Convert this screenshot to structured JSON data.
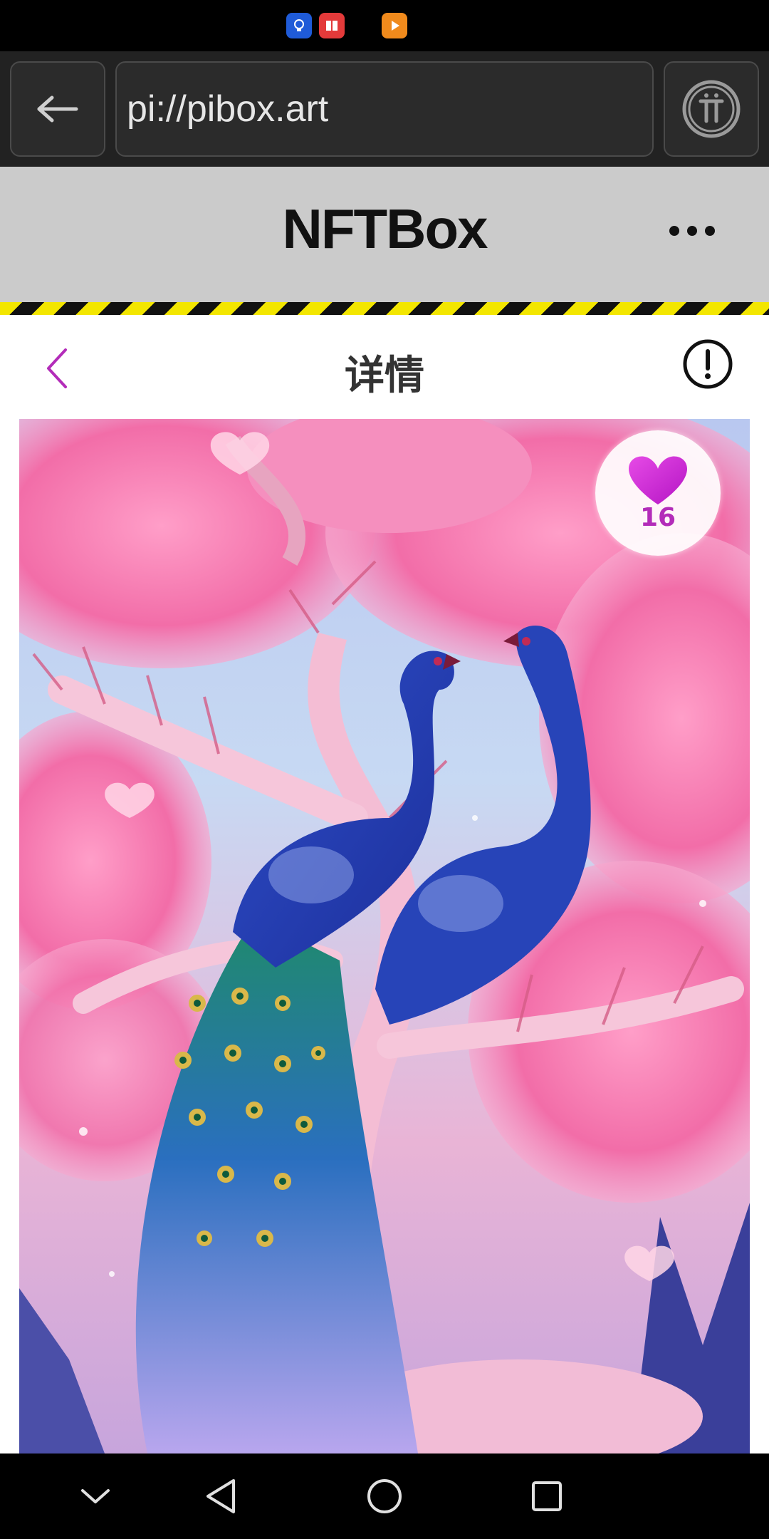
{
  "status_bar": {
    "icons": [
      "bulb-app-icon",
      "book-app-icon",
      "play-app-icon"
    ]
  },
  "browser": {
    "url": "pi://pibox.art",
    "back_icon": "arrow-left-icon",
    "pi_icon": "pi-logo-icon"
  },
  "app_header": {
    "title": "NFTBox",
    "menu_icon": "more-horizontal-icon"
  },
  "detail": {
    "title": "详情",
    "back_icon": "chevron-left-icon",
    "info_icon": "info-circle-icon"
  },
  "artwork": {
    "like_count": "16",
    "like_icon": "heart-icon"
  },
  "nav_bar": {
    "icons": [
      "chevron-down-icon",
      "back-triangle-icon",
      "home-circle-icon",
      "recents-square-icon"
    ]
  },
  "colors": {
    "accent": "#b32cb9",
    "header_bg": "#cbcbcb",
    "hazard_yellow": "#f3e600"
  }
}
